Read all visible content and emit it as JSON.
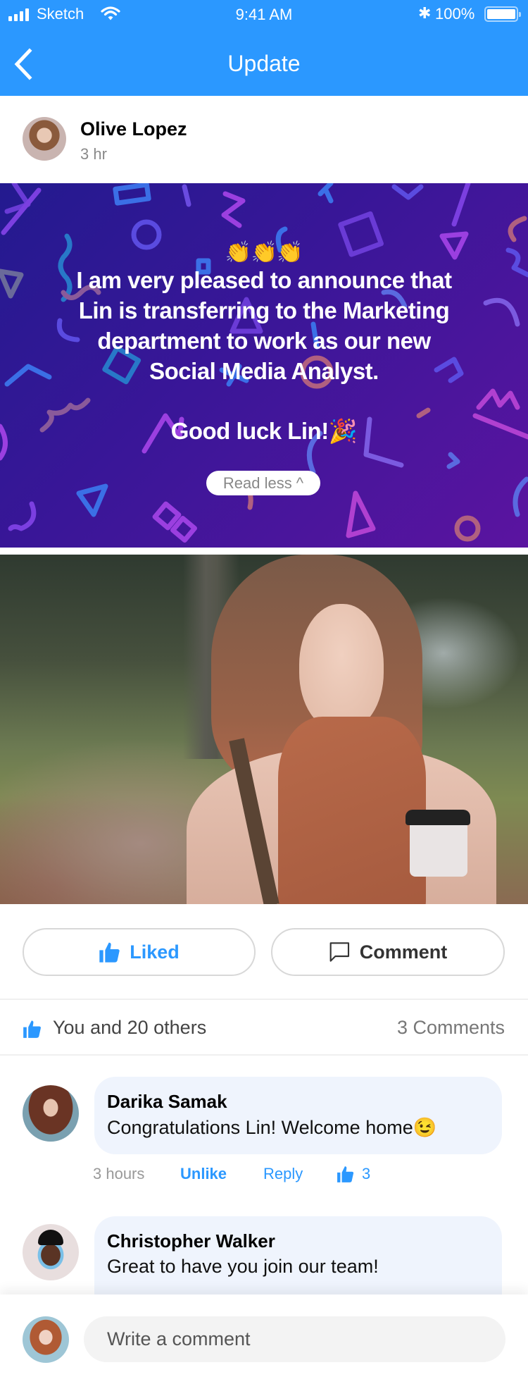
{
  "status_bar": {
    "carrier": "Sketch",
    "time": "9:41 AM",
    "battery": "100%"
  },
  "header": {
    "title": "Update",
    "back_icon": "chevron-left-icon"
  },
  "post": {
    "author": "Olive Lopez",
    "time": "3 hr",
    "banner": {
      "emoji": "👏👏👏",
      "lines": [
        "I am very pleased to announce that",
        "Lin is transferring to the Marketing",
        "department to work as our new",
        "Social Media Analyst."
      ],
      "closing": "Good luck Lin!🎉",
      "read_less": "Read less ^",
      "colors": {
        "start": "#231A8F",
        "end": "#5B14A0"
      }
    },
    "photo_alt": "Smiling woman with scarf holding a coffee cup"
  },
  "actions": {
    "like_label": "Liked",
    "comment_label": "Comment"
  },
  "reactions": {
    "likes_text": "You and 20 others",
    "comments_text": "3 Comments"
  },
  "comments": [
    {
      "name": "Darika Samak",
      "text": "Congratulations Lin! Welcome home😉",
      "time": "3 hours",
      "unlike": "Unlike",
      "reply": "Reply",
      "likes": "3"
    },
    {
      "name": "Christopher Walker",
      "text": "Great to have you join our team!"
    }
  ],
  "composer": {
    "placeholder": "Write a comment"
  },
  "colors": {
    "accent": "#2B98FF",
    "bubble": "#EFF4FD"
  }
}
